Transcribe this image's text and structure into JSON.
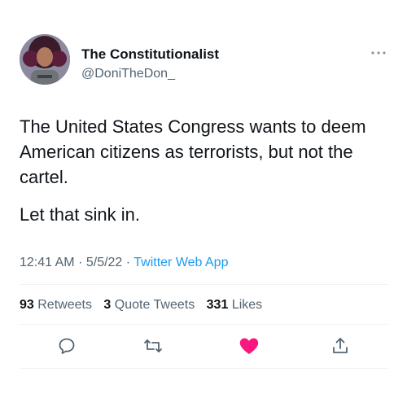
{
  "author": {
    "display_name": "The Constitutionalist",
    "handle": "@DoniTheDon_",
    "avatar_icon": "profile-photo"
  },
  "tweet": {
    "paragraphs": [
      "The United States Congress wants to deem American citizens as terrorists, but not the cartel.",
      "Let that sink in."
    ],
    "time": "12:41 AM",
    "date": "5/5/22",
    "separator": "·",
    "source": "Twitter Web App"
  },
  "stats": {
    "retweets_count": "93",
    "retweets_label": "Retweets",
    "quotes_count": "3",
    "quotes_label": "Quote Tweets",
    "likes_count": "331",
    "likes_label": "Likes"
  },
  "actions": {
    "reply_icon": "reply-icon",
    "retweet_icon": "retweet-icon",
    "like_icon": "heart-icon",
    "like_active": true,
    "share_icon": "share-icon"
  },
  "colors": {
    "text": "#0f1419",
    "secondary": "#536471",
    "link": "#1d9bf0",
    "like": "#f91880",
    "divider": "#eff3f4"
  }
}
